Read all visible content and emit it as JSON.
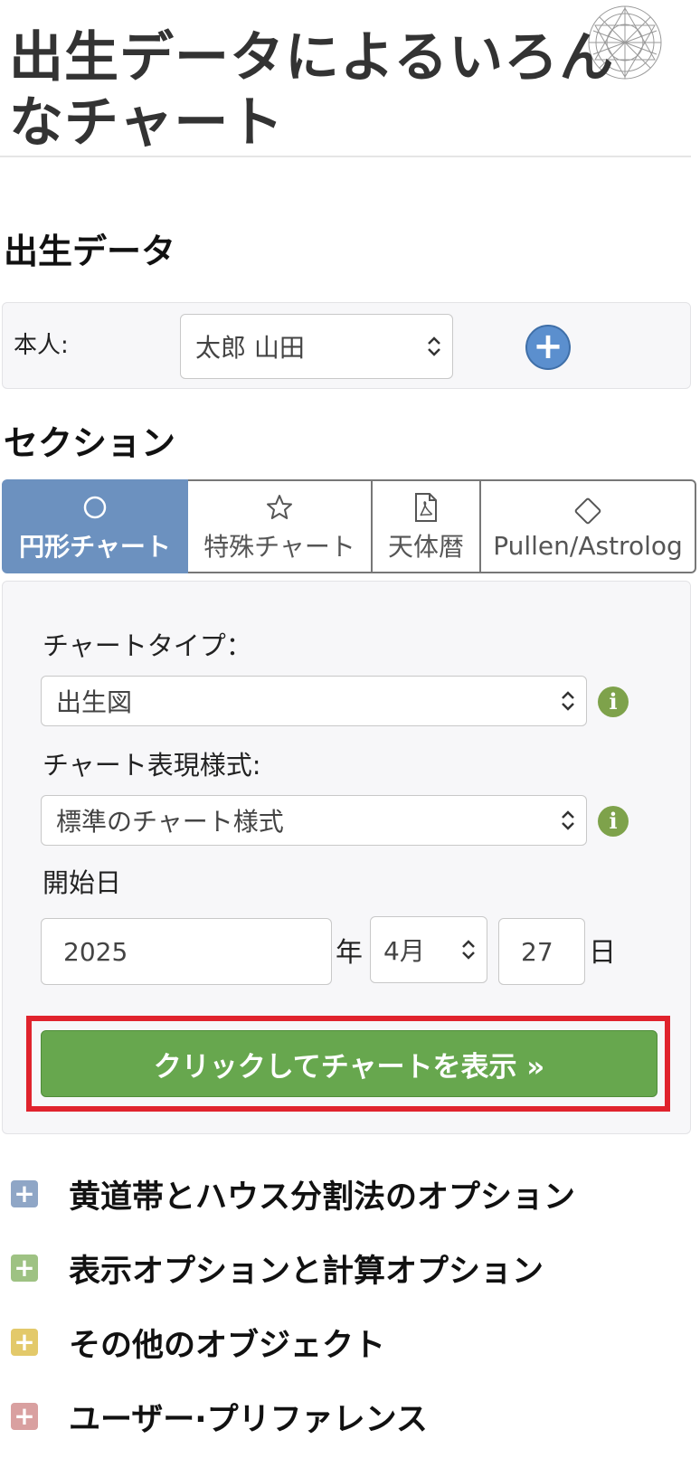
{
  "page": {
    "title": "出生データによるいろんなチャート"
  },
  "birth_data": {
    "heading": "出生データ",
    "person_label": "本人:",
    "person_selected": "太郎 山田",
    "add_person_symbol": "+"
  },
  "sections": {
    "heading": "セクション",
    "tabs": [
      {
        "label": "円形チャート",
        "icon": "circle-icon",
        "active": true
      },
      {
        "label": "特殊チャート",
        "icon": "star-icon",
        "active": false
      },
      {
        "label": "天体暦",
        "icon": "pdf-file-icon",
        "active": false
      },
      {
        "label": "Pullen/Astrolog",
        "icon": "diamond-icon",
        "active": false
      }
    ]
  },
  "form": {
    "chart_type_label": "チャートタイプ：",
    "chart_type_value": "出生図",
    "chart_style_label": "チャート表現様式:",
    "chart_style_value": "標準のチャート様式",
    "start_date_label": "開始日",
    "year_value": "2025",
    "year_unit": "年",
    "month_value": "4月",
    "day_value": "27",
    "day_unit": "日",
    "info_symbol": "i",
    "submit_label": "クリックしてチャートを表示 »"
  },
  "options": [
    {
      "label": "黄道帯とハウス分割法のオプション",
      "color": "#8fa6c6"
    },
    {
      "label": "表示オプションと計算オプション",
      "color": "#9ec283"
    },
    {
      "label": "その他のオブジェクト",
      "color": "#e3c96a"
    },
    {
      "label": "ユーザー·プリファレンス",
      "color": "#d9a0a0"
    }
  ],
  "colors": {
    "accent_tab": "#6c91bf",
    "submit_button": "#67a74e",
    "highlight_frame": "#e0232d",
    "info_icon": "#7ea24b",
    "add_button": "#5b8fce"
  }
}
